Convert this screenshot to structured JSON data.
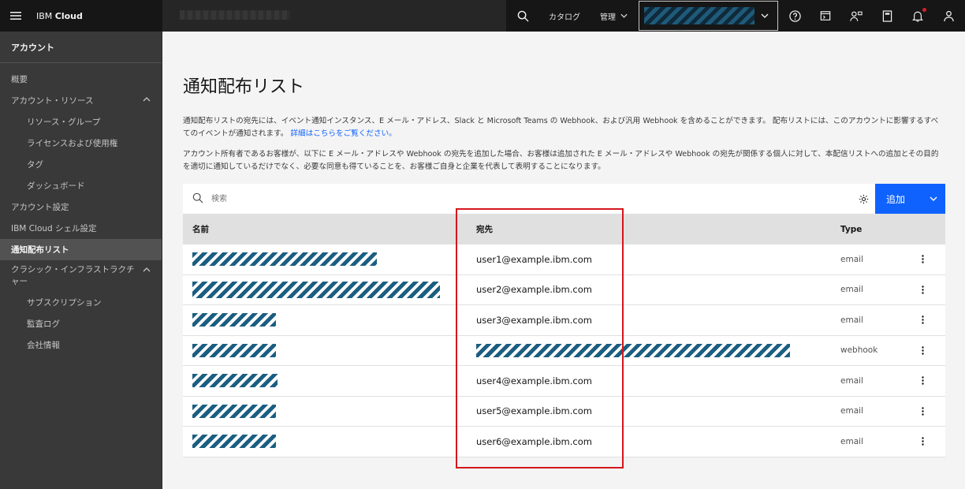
{
  "header": {
    "brand_prefix": "IBM",
    "brand_name": "Cloud",
    "catalog_label": "カタログ",
    "manage_label": "管理",
    "icons": [
      "menu-icon",
      "search-icon",
      "chevron-down-icon",
      "help-icon",
      "cost-estimator-icon",
      "switch-user-icon",
      "calculator-icon",
      "notification-icon",
      "user-icon"
    ]
  },
  "sidebar": {
    "title": "アカウント",
    "items": [
      {
        "label": "概要"
      },
      {
        "label": "アカウント・リソース"
      },
      {
        "label": "リソース・グループ"
      },
      {
        "label": "ライセンスおよび使用権"
      },
      {
        "label": "タグ"
      },
      {
        "label": "ダッシュボード"
      },
      {
        "label": "アカウント設定"
      },
      {
        "label": "IBM Cloud シェル設定"
      },
      {
        "label": "通知配布リスト"
      },
      {
        "label": "クラシック・インフラストラクチャー"
      },
      {
        "label": "サブスクリプション"
      },
      {
        "label": "監査ログ"
      },
      {
        "label": "会社情報"
      }
    ],
    "active_item": "通知配布リスト"
  },
  "main": {
    "title": "通知配布リスト",
    "description1": "通知配布リストの宛先には、イベント通知インスタンス、E メール・アドレス、Slack と Microsoft Teams の Webhook、および汎用 Webhook を含めることができます。 配布リストには、このアカウントに影響するすべてのイベントが通知されます。",
    "learn_more_link": "詳細はこちらをご覧ください。",
    "description2": "アカウント所有者であるお客様が、以下に E メール・アドレスや Webhook の宛先を追加した場合、お客様は追加された E メール・アドレスや Webhook の宛先が関係する個人に対して、本配信リストへの追加とその目的を適切に通知しているだけでなく、必要な同意も得ていることを、お客様ご自身と企業を代表して表明することになります。",
    "search_placeholder": "検索",
    "add_button_label": "追加",
    "table": {
      "columns": {
        "name": "名前",
        "destination": "宛先",
        "type": "Type"
      },
      "rows": [
        {
          "destination": "user1@example.ibm.com",
          "type": "email"
        },
        {
          "destination": "user2@example.ibm.com",
          "type": "email"
        },
        {
          "destination": "user3@example.ibm.com",
          "type": "email"
        },
        {
          "destination": "",
          "type": "webhook"
        },
        {
          "destination": "user4@example.ibm.com",
          "type": "email"
        },
        {
          "destination": "user5@example.ibm.com",
          "type": "email"
        },
        {
          "destination": "user6@example.ibm.com",
          "type": "email"
        }
      ]
    }
  },
  "colors": {
    "header_bg": "#161616",
    "sidebar_bg": "#393939",
    "primary": "#0f62fe",
    "highlight": "#d4161d"
  }
}
